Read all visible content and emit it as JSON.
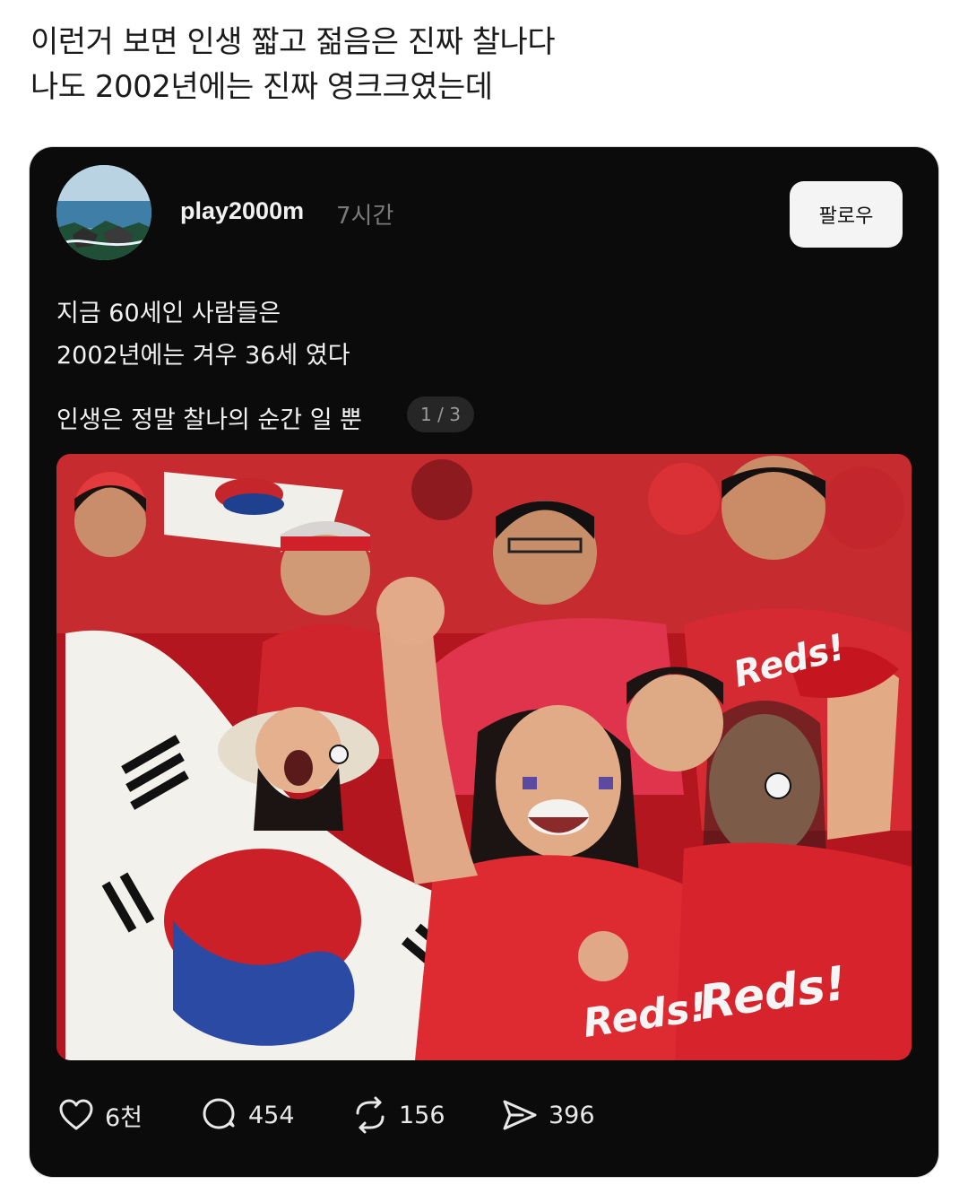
{
  "caption": {
    "line1": "이런거 보면 인생 짧고 젊음은 진짜 찰나다",
    "line2": "나도 2002년에는 진짜 영크크였는데"
  },
  "post": {
    "username": "play2000m",
    "time": "7시간",
    "follow_label": "팔로우",
    "text_lines": [
      "지금 60세인 사람들은",
      "2002년에는 겨우 36세 였다",
      "인생은 정말 찰나의 순간 일 뿐"
    ],
    "page_indicator": "1 / 3",
    "photo_text": {
      "shirt_1": "Reds!",
      "shirt_2": "Reds!",
      "shirt_3": "Reds!"
    }
  },
  "actions": {
    "likes": "6천",
    "replies": "454",
    "reposts": "156",
    "shares": "396"
  },
  "icons": {
    "like": "heart-icon",
    "reply": "comment-bubble-icon",
    "repost": "repost-arrows-icon",
    "share": "send-arrow-icon"
  },
  "colors": {
    "card_bg": "#0b0b0b",
    "follow_bg": "#f4f4f4",
    "muted_text": "#7a7a7a",
    "jersey_red": "#d3202a"
  }
}
